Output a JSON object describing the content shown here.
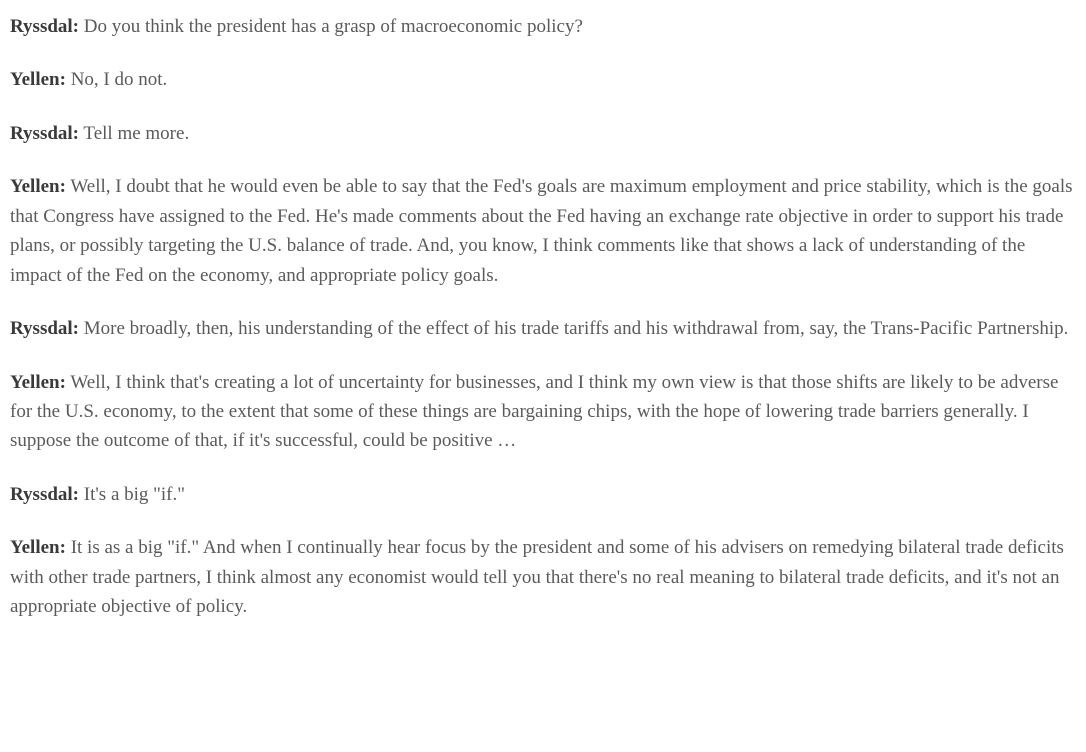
{
  "interview": [
    {
      "speaker": "Ryssdal:",
      "text": " Do you think the president has a grasp of macroeconomic policy?"
    },
    {
      "speaker": "Yellen:",
      "text": " No, I do not."
    },
    {
      "speaker": "Ryssdal:",
      "text": " Tell me more."
    },
    {
      "speaker": "Yellen:",
      "text": " Well, I doubt that he would even be able to say that the Fed's goals are maximum employment and price stability, which is the goals that Congress have assigned to the Fed. He's made comments about the Fed having an exchange rate objective in order to support his trade plans, or possibly targeting the U.S. balance of trade. And, you know, I think comments like that shows a lack of understanding of the impact of the Fed on the economy, and appropriate policy goals."
    },
    {
      "speaker": "Ryssdal:",
      "text": " More broadly, then, his understanding of the effect of his trade tariffs and his withdrawal from, say, the Trans-Pacific Partnership."
    },
    {
      "speaker": "Yellen:",
      "text": " Well, I think that's creating a lot of uncertainty for businesses, and I think my own view is that those shifts are likely to be adverse for the U.S. economy, to the extent that some of these things are bargaining chips, with the hope of lowering trade barriers generally. I suppose the outcome of that, if it's successful, could be positive …"
    },
    {
      "speaker": "Ryssdal:",
      "text": " It's a big \"if.\""
    },
    {
      "speaker": "Yellen:",
      "text": " It is as a big \"if.\" And when I continually hear focus by the president and some of his advisers on remedying bilateral trade deficits with other trade partners, I think almost any economist would tell you that there's no real meaning to bilateral trade deficits, and it's not an appropriate objective of policy."
    }
  ]
}
